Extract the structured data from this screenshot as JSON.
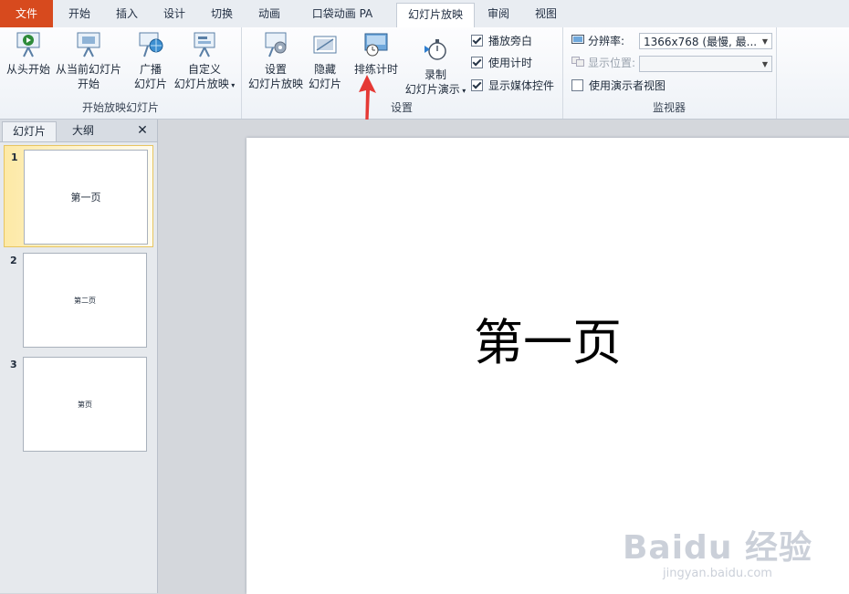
{
  "tabs": [
    "文件",
    "开始",
    "插入",
    "设计",
    "切换",
    "动画",
    "口袋动画 PA",
    "幻灯片放映",
    "审阅",
    "视图"
  ],
  "ribbon": {
    "group_start": {
      "label": "开始放映幻灯片",
      "from_beginning": "从头开始",
      "from_current_1": "从当前幻灯片",
      "from_current_2": "开始",
      "broadcast_1": "广播",
      "broadcast_2": "幻灯片",
      "custom_1": "自定义",
      "custom_2": "幻灯片放映"
    },
    "group_setup": {
      "label": "设置",
      "setup_1": "设置",
      "setup_2": "幻灯片放映",
      "hide_1": "隐藏",
      "hide_2": "幻灯片",
      "rehearse": "排练计时",
      "record_1": "录制",
      "record_2": "幻灯片演示",
      "check_narration": "播放旁白",
      "check_timings": "使用计时",
      "check_media": "显示媒体控件"
    },
    "group_monitor": {
      "label": "监视器",
      "resolution_label": "分辨率:",
      "resolution_value": "1366x768 (最慢, 最...",
      "display_label": "显示位置:",
      "presenter_view": "使用演示者视图"
    }
  },
  "panel": {
    "tab_slides": "幻灯片",
    "tab_outline": "大纲",
    "close": "✕",
    "slides": [
      {
        "num": "1",
        "text": "第一页"
      },
      {
        "num": "2",
        "text": "第二页"
      },
      {
        "num": "3",
        "text": "第页"
      }
    ]
  },
  "slide": {
    "title": "第一页"
  },
  "watermark": {
    "line1": "Baidu 经验",
    "line2": "jingyan.baidu.com"
  },
  "colors": {
    "file_tab": "#d74a1e",
    "arrow": "#e53935"
  }
}
